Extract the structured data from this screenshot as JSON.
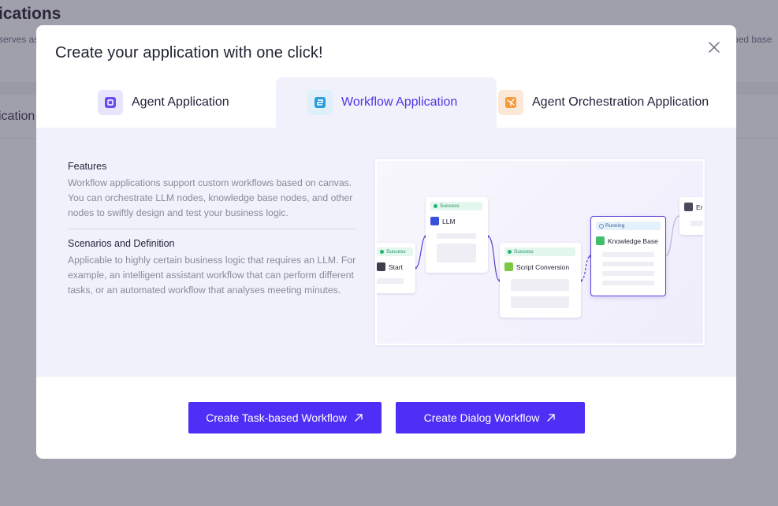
{
  "background": {
    "title": "ications",
    "subtitle_left": "serves as",
    "subtitle_right": "ped base",
    "tab_label": "ication"
  },
  "modal": {
    "title": "Create your application with one click!",
    "close_icon": "close-icon",
    "tabs": [
      {
        "label": "Agent Application",
        "icon": "agent-icon",
        "active": false
      },
      {
        "label": "Workflow Application",
        "icon": "workflow-icon",
        "active": true
      },
      {
        "label": "Agent Orchestration Application",
        "icon": "orchestration-icon",
        "active": false
      }
    ],
    "features": {
      "heading": "Features",
      "text": "Workflow applications support custom workflows based on canvas. You can orchestrate LLM nodes, knowledge base nodes, and other nodes to swiftly design and test your business logic."
    },
    "scenarios": {
      "heading": "Scenarios and Definition",
      "text": "Applicable to highly certain business logic that requires an LLM. For example, an intelligent assistant workflow that can perform different tasks, or an automated workflow that analyses meeting minutes."
    },
    "preview": {
      "nodes": [
        {
          "name": "Start",
          "status": "Success"
        },
        {
          "name": "LLM",
          "status": "Success"
        },
        {
          "name": "Script Conversion",
          "status": "Success"
        },
        {
          "name": "Knowledge Base",
          "status": "Running"
        },
        {
          "name": "Er",
          "status": ""
        }
      ]
    },
    "buttons": {
      "task": "Create Task-based Workflow",
      "dialog": "Create Dialog Workflow",
      "icon": "arrow-up-right-icon"
    }
  },
  "colors": {
    "accent": "#4f2ff5",
    "active_tab_text": "#4f35e8",
    "panel_bg": "#f1f1fc",
    "overlay": "#a3a1ad"
  }
}
